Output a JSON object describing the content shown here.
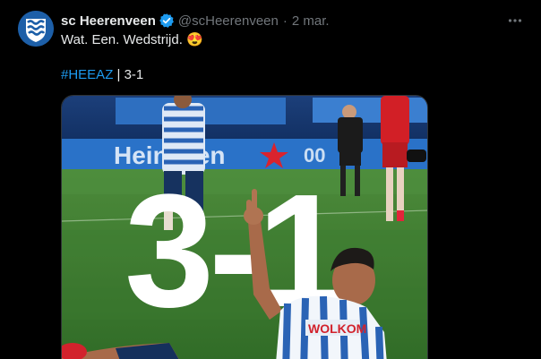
{
  "tweet": {
    "display_name": "sc Heerenveen",
    "handle": "@scHeerenveen",
    "separator": "·",
    "time": "2 mar.",
    "text": "Wat. Een. Wedstrijd. 😍",
    "hashtag": "#HEEAZ",
    "hashtag_suffix": " | 3-1"
  },
  "icons": {
    "avatar": "club-crest-icon",
    "verified": "verified-badge-icon",
    "more": "more-dots-icon"
  },
  "media": {
    "score_text": "3-1",
    "board_text": "Heineken",
    "board_number": "00",
    "shirt_text": "WOLKOM"
  },
  "colors": {
    "background": "#000000",
    "text": "#e7e9ea",
    "muted": "#71767b",
    "link": "#1d9bf0",
    "verified": "#1d9bf0"
  }
}
